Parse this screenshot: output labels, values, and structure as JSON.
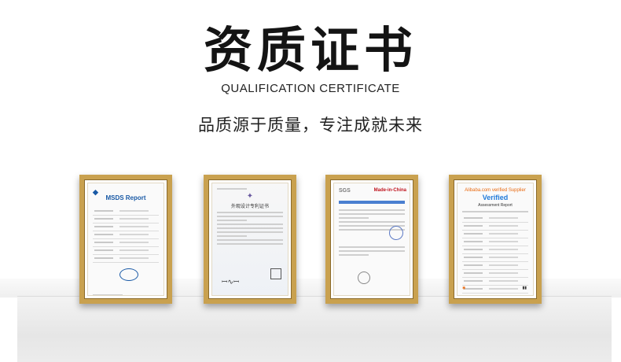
{
  "header": {
    "title": "资质证书",
    "subtitle": "QUALIFICATION CERTIFICATE",
    "slogan": "品质源于质量，专注成就未来"
  },
  "certificates": [
    {
      "heading": "MSDS Report"
    },
    {
      "heading": "外观设计专利证书"
    },
    {
      "logo_left": "SGS",
      "logo_right": "Made-in-China"
    },
    {
      "logo": "Alibaba.com verified Supplier",
      "heading": "Verified",
      "sub": "Assessment Report"
    }
  ],
  "colors": {
    "frame": "#c9a14f",
    "title": "#141414",
    "accent_blue": "#1a5aa6"
  }
}
